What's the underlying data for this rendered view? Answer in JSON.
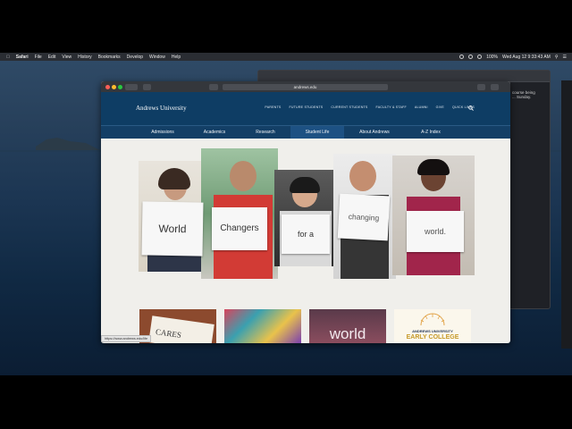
{
  "menubar": {
    "app": "Safari",
    "items": [
      "File",
      "Edit",
      "View",
      "History",
      "Bookmarks",
      "Develop",
      "Window",
      "Help"
    ],
    "battery": "100%",
    "datetime": "Wed Aug 12  9:33:43 AM"
  },
  "background_window": {
    "text": "course being ... Sunday."
  },
  "browser": {
    "url": "andrews.edu",
    "status_url": "https://www.andrews.edu/life"
  },
  "site": {
    "logo": "Andrews University",
    "top_nav": [
      "PARENTS",
      "FUTURE STUDENTS",
      "CURRENT STUDENTS",
      "FACULTY & STAFF",
      "ALUMNI",
      "GIVE",
      "QUICK LINKS"
    ],
    "main_nav": [
      "Admissions",
      "Academics",
      "Research",
      "Student Life",
      "About Andrews",
      "A-Z Index"
    ],
    "hero_signs": [
      "World",
      "Changers",
      "for a",
      "changing",
      "world."
    ],
    "tiles": [
      {
        "text": "CARES"
      },
      {
        "text": ""
      },
      {
        "text": "world"
      },
      {
        "line1": "ANDREWS UNIVERSITY",
        "line2": "EARLY COLLEGE"
      }
    ]
  },
  "colors": {
    "header": "#0e3d64",
    "nav": "#133f66",
    "page_bg": "#f0efeb",
    "early_college_gold": "#c79a2a"
  }
}
